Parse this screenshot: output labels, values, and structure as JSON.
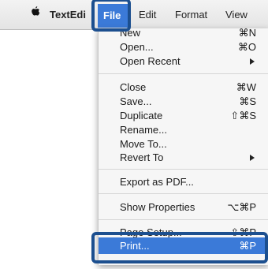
{
  "menubar": {
    "apple_icon": "apple-logo-icon",
    "app_name": "TextEdi",
    "file": "File",
    "edit": "Edit",
    "format": "Format",
    "view": "View"
  },
  "file_menu": {
    "new": {
      "label": "New",
      "shortcut": "⌘N"
    },
    "open": {
      "label": "Open...",
      "shortcut": "⌘O"
    },
    "open_recent": {
      "label": "Open Recent",
      "submenu_icon": "triangle-right-icon"
    },
    "close": {
      "label": "Close",
      "shortcut": "⌘W"
    },
    "save": {
      "label": "Save...",
      "shortcut": "⌘S"
    },
    "duplicate": {
      "label": "Duplicate",
      "shortcut": "⇧⌘S"
    },
    "rename": {
      "label": "Rename..."
    },
    "move_to": {
      "label": "Move To..."
    },
    "revert_to": {
      "label": "Revert To",
      "submenu_icon": "triangle-right-icon"
    },
    "export_pdf": {
      "label": "Export as PDF..."
    },
    "show_properties": {
      "label": "Show Properties",
      "shortcut": "⌥⌘P"
    },
    "page_setup": {
      "label": "Page Setup...",
      "shortcut": "⇧⌘P"
    },
    "print": {
      "label": "Print...",
      "shortcut": "⌘P"
    }
  },
  "colors": {
    "highlight": "#3b7ad8",
    "callout": "#1c4f8f"
  }
}
